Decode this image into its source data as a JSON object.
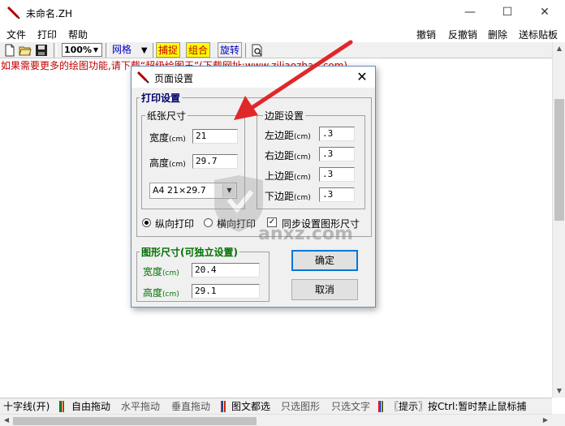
{
  "window": {
    "title": "未命名.ZH",
    "minimize": "—",
    "maximize": "☐",
    "close": "✕"
  },
  "menu": {
    "left": [
      "文件",
      "打印",
      "帮助"
    ],
    "right": [
      "撤销",
      "反撤销",
      "删除",
      "送标贴板"
    ]
  },
  "toolbar": {
    "zoom": "100%",
    "grid": "网格",
    "capture": "捕捉",
    "combine": "组合",
    "rotate": "旋转"
  },
  "canvas": {
    "hint": "如果需要更多的绘图功能,请下载“超级绘图王”(下载网址:www.ziliaozhan.com)"
  },
  "dialog": {
    "title": "页面设置",
    "close": "✕",
    "print_group": "打印设置",
    "paper_group": "纸张尺寸",
    "width_label": "宽度",
    "height_label": "高度",
    "unit": "(cm)",
    "paper_width": "21",
    "paper_height": "29.7",
    "paper_select": "A4 21×29.7",
    "margin_group": "边距设置",
    "left_margin_label": "左边距",
    "right_margin_label": "右边距",
    "top_margin_label": "上边距",
    "bottom_margin_label": "下边距",
    "left_margin": ".3",
    "right_margin": ".3",
    "top_margin": ".3",
    "bottom_margin": ".3",
    "portrait": "纵向打印",
    "landscape": "横向打印",
    "sync": "同步设置图形尺寸",
    "shape_group": "图形尺寸(可独立设置)",
    "shape_width_label": "宽度",
    "shape_height_label": "高度",
    "shape_width": "20.4",
    "shape_height": "29.1",
    "ok": "确定",
    "cancel": "取消"
  },
  "status": {
    "items": [
      "十字线(开)",
      "自由拖动",
      "水平拖动",
      "垂直拖动",
      "图文都选",
      "只选图形",
      "只选文字",
      "〖提示〗按Ctrl:暂时禁止鼠标捕"
    ]
  },
  "watermark": "anxz.com",
  "colors": {
    "hint": "#c00000",
    "arrow": "#e0282a",
    "group_title": "#00006b",
    "shape_group_title": "#007000",
    "accent": "#0078d7"
  }
}
